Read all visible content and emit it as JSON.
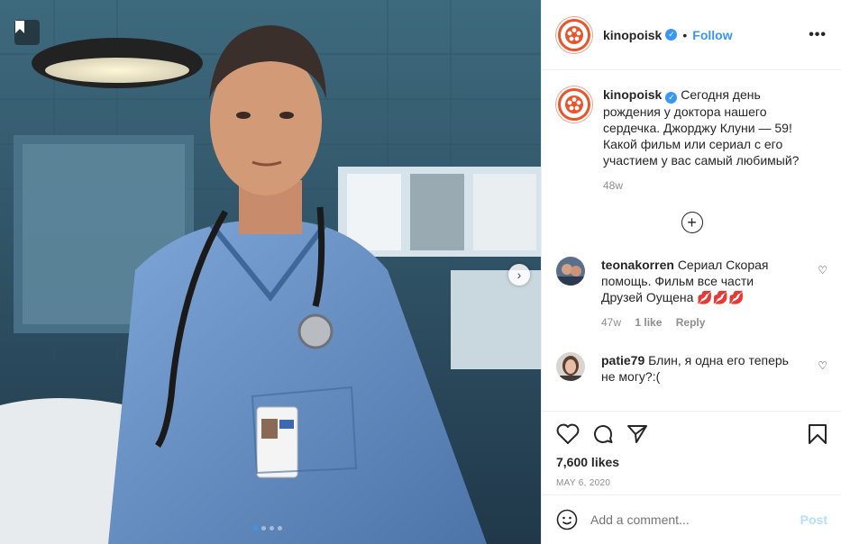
{
  "post": {
    "username": "kinopoisk",
    "verified": true,
    "follow_label": "Follow",
    "separator": "•",
    "more_label": "•••",
    "caption": "Сегодня день рождения у доктора нашего сердечка. Джорджу Клуни — 59! Какой фильм или сериал с его участием у вас самый любимый?",
    "caption_time": "48w",
    "load_more": "+",
    "likes": "7,600 likes",
    "date": "MAY 6, 2020",
    "carousel_next": "›"
  },
  "comments": [
    {
      "username": "teonakorren",
      "text": "Сериал Скорая помощь. Фильм все части Друзей Оущена",
      "emoji": "💋💋💋",
      "time": "47w",
      "likes": "1 like",
      "reply": "Reply"
    },
    {
      "username": "patie79",
      "text": "Блин, я одна его теперь не могу?:("
    }
  ],
  "add_comment": {
    "placeholder": "Add a comment...",
    "post_label": "Post"
  },
  "icons": {
    "brand_color": "#e8542b",
    "accent": "#3897f0"
  }
}
